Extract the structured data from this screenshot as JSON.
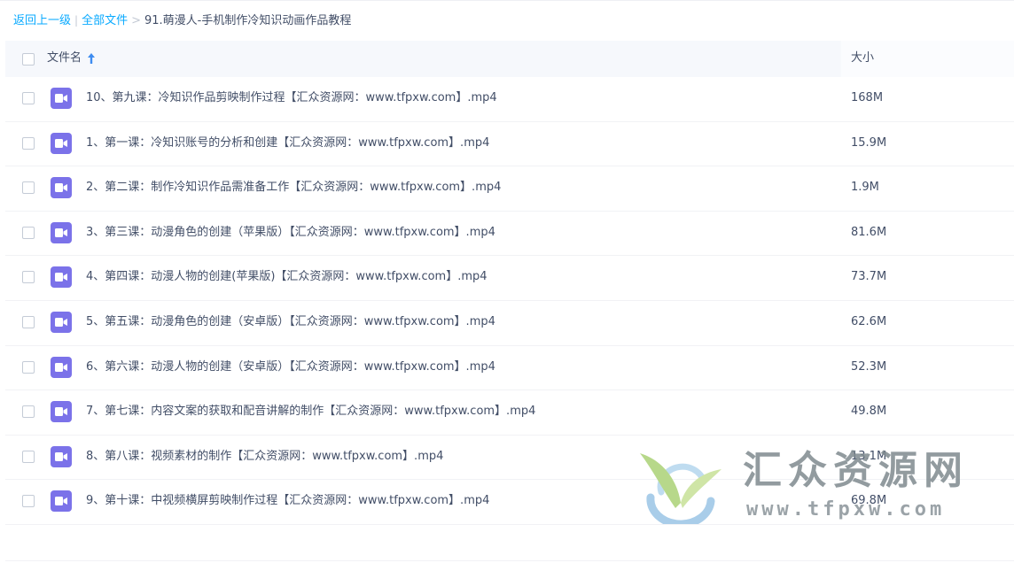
{
  "breadcrumb": {
    "back": "返回上一级",
    "divider": "|",
    "all_files": "全部文件",
    "arrow": ">",
    "current": "91.萌漫人-手机制作冷知识动画作品教程"
  },
  "table": {
    "header": {
      "name": "文件名",
      "size": "大小"
    },
    "rows": [
      {
        "name": "10、第九课：冷知识作品剪映制作过程【汇众资源网：www.tfpxw.com】.mp4",
        "size": "168M"
      },
      {
        "name": "1、第一课：冷知识账号的分析和创建【汇众资源网：www.tfpxw.com】.mp4",
        "size": "15.9M"
      },
      {
        "name": "2、第二课：制作冷知识作品需准备工作【汇众资源网：www.tfpxw.com】.mp4",
        "size": "1.9M"
      },
      {
        "name": "3、第三课：动漫角色的创建（苹果版）【汇众资源网：www.tfpxw.com】.mp4",
        "size": "81.6M"
      },
      {
        "name": "4、第四课：动漫人物的创建(苹果版)【汇众资源网：www.tfpxw.com】.mp4",
        "size": "73.7M"
      },
      {
        "name": "5、第五课：动漫角色的创建（安卓版）【汇众资源网：www.tfpxw.com】.mp4",
        "size": "62.6M"
      },
      {
        "name": "6、第六课：动漫人物的创建（安卓版）【汇众资源网：www.tfpxw.com】.mp4",
        "size": "52.3M"
      },
      {
        "name": "7、第七课：内容文案的获取和配音讲解的制作【汇众资源网：www.tfpxw.com】.mp4",
        "size": "49.8M"
      },
      {
        "name": "8、第八课：视频素材的制作【汇众资源网：www.tfpxw.com】.mp4",
        "size": "13.1M"
      },
      {
        "name": "9、第十课：中视频横屏剪映制作过程【汇众资源网：www.tfpxw.com】.mp4",
        "size": "69.8M"
      }
    ]
  },
  "watermark": {
    "title": "汇众资源网",
    "url": "www.tfpxw.com"
  },
  "colors": {
    "link": "#09aaff",
    "text": "#424e67",
    "video_icon": "#7b72e9",
    "header_bg": "#f6f8fc"
  },
  "icons": {
    "sort": "arrow-up-icon",
    "file": "video-file-icon"
  }
}
